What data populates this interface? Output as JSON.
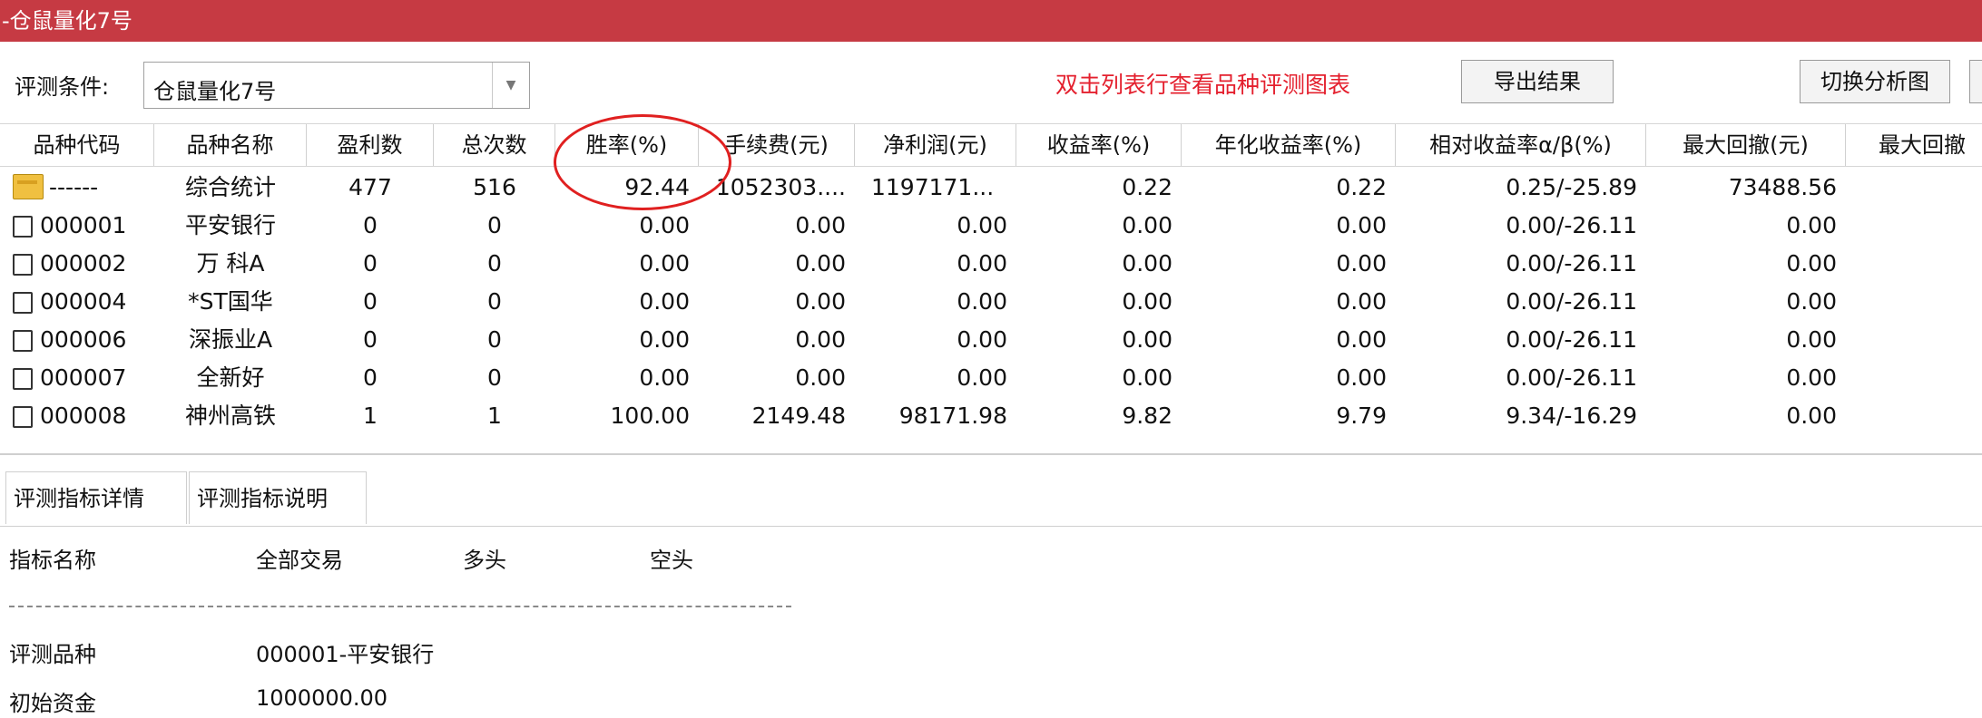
{
  "window": {
    "title": "-仓鼠量化7号"
  },
  "toolbar": {
    "condition_label": "评测条件:",
    "condition_value": "仓鼠量化7号",
    "hint": "双击列表行查看品种评测图表",
    "export_button": "导出结果",
    "switch_button": "切换分析图"
  },
  "table": {
    "columns": [
      "品种代码",
      "品种名称",
      "盈利数",
      "总次数",
      "胜率(%)",
      "手续费(元)",
      "净利润(元)",
      "收益率(%)",
      "年化收益率(%)",
      "相对收益率α/β(%)",
      "最大回撤(元)",
      "最大回撤"
    ],
    "summary": {
      "code": "------",
      "name": "综合统计",
      "wins": "477",
      "total": "516",
      "win_rate": "92.44",
      "fee": "1052303....",
      "net_profit": "1197171...",
      "return_rate": "0.22",
      "annual_return": "0.22",
      "alpha_beta": "0.25/-25.89",
      "max_drawdown": "73488.56"
    },
    "rows": [
      {
        "code": "000001",
        "name": "平安银行",
        "wins": "0",
        "total": "0",
        "win_rate": "0.00",
        "fee": "0.00",
        "net_profit": "0.00",
        "return_rate": "0.00",
        "annual_return": "0.00",
        "alpha_beta": "0.00/-26.11",
        "max_drawdown": "0.00"
      },
      {
        "code": "000002",
        "name": "万 科A",
        "wins": "0",
        "total": "0",
        "win_rate": "0.00",
        "fee": "0.00",
        "net_profit": "0.00",
        "return_rate": "0.00",
        "annual_return": "0.00",
        "alpha_beta": "0.00/-26.11",
        "max_drawdown": "0.00"
      },
      {
        "code": "000004",
        "name": "*ST国华",
        "wins": "0",
        "total": "0",
        "win_rate": "0.00",
        "fee": "0.00",
        "net_profit": "0.00",
        "return_rate": "0.00",
        "annual_return": "0.00",
        "alpha_beta": "0.00/-26.11",
        "max_drawdown": "0.00"
      },
      {
        "code": "000006",
        "name": "深振业A",
        "wins": "0",
        "total": "0",
        "win_rate": "0.00",
        "fee": "0.00",
        "net_profit": "0.00",
        "return_rate": "0.00",
        "annual_return": "0.00",
        "alpha_beta": "0.00/-26.11",
        "max_drawdown": "0.00"
      },
      {
        "code": "000007",
        "name": "全新好",
        "wins": "0",
        "total": "0",
        "win_rate": "0.00",
        "fee": "0.00",
        "net_profit": "0.00",
        "return_rate": "0.00",
        "annual_return": "0.00",
        "alpha_beta": "0.00/-26.11",
        "max_drawdown": "0.00"
      },
      {
        "code": "000008",
        "name": "神州高铁",
        "wins": "1",
        "total": "1",
        "win_rate": "100.00",
        "fee": "2149.48",
        "net_profit": "98171.98",
        "return_rate": "9.82",
        "annual_return": "9.79",
        "alpha_beta": "9.34/-16.29",
        "max_drawdown": "0.00"
      }
    ]
  },
  "tabs": {
    "active": "评测指标详情",
    "inactive": "评测指标说明"
  },
  "details": {
    "header": {
      "metric": "指标名称",
      "all": "全部交易",
      "long": "多头",
      "short": "空头"
    },
    "divider": "------------------------------------------------------------------------------------",
    "rows": [
      {
        "label": "评测品种",
        "value": "000001-平安银行"
      },
      {
        "label": "初始资金",
        "value": "1000000.00"
      }
    ]
  }
}
